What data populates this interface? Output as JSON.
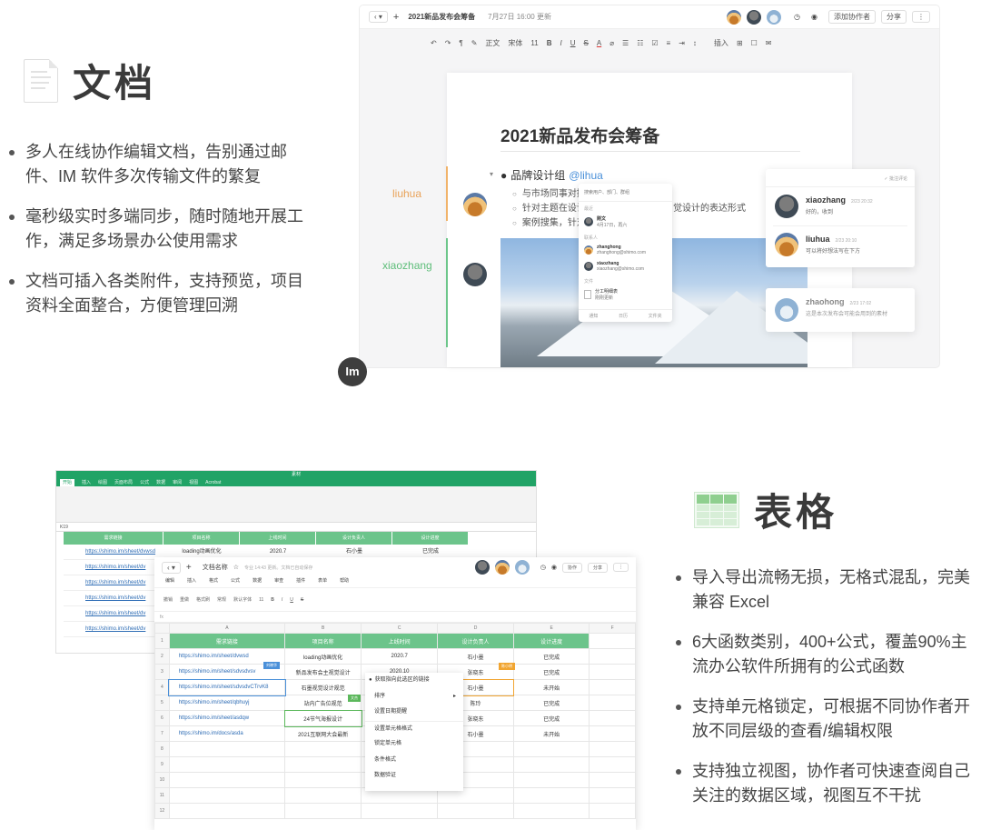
{
  "doc_section": {
    "title": "文档",
    "bullets": [
      "多人在线协作编辑文档，告别通过邮件、IM 软件多次传输文件的繁复",
      "毫秒级实时多端同步，随时随地开展工作，满足多场景办公使用需求",
      "文档可插入各类附件，支持预览，项目资料全面整合，方便管理回溯"
    ]
  },
  "doc_editor": {
    "file_name": "2021新品发布会筹备",
    "updated": "7月27日 16:00 更新",
    "add_collaborator": "添加协作者",
    "share": "分享",
    "toolbar": [
      "正文",
      "宋体",
      "11",
      "B",
      "I",
      "U",
      "S",
      "A",
      "插入"
    ],
    "heading": "2021新品发布会筹备",
    "item": "品牌设计组",
    "mention": "@lihua",
    "sub_items": [
      "与市场同事对接",
      "针对主题在设计",
      "案例搜集，针对"
    ],
    "sub_item_tail": "觉设计的表达形式",
    "margin_labels": [
      "liuhua",
      "xiaozhang"
    ],
    "mention_popup": {
      "search": "搜索用户、部门、群组",
      "recent_label": "最近",
      "contacts_label": "联系人",
      "file_label": "文件",
      "entries": [
        {
          "name": "刚文",
          "sub": "4月17日，再六"
        },
        {
          "name": "zhanghong",
          "sub": "zhanghong@shimo.com"
        },
        {
          "name": "xiaozhang",
          "sub": "xiaozhang@shimo.com"
        },
        {
          "name": "分工明细表",
          "sub": "刚刚更新"
        }
      ],
      "footer": [
        "通知",
        "日历",
        "文件夹"
      ]
    },
    "comments_header": "批注评论",
    "comments": [
      {
        "name": "xiaozhang",
        "time": "2/23 20:32",
        "text": "好的，收到"
      },
      {
        "name": "liuhua",
        "time": "2/23 20:10",
        "text": "可以将好想法写在下方"
      },
      {
        "name": "zhaohong",
        "time": "2/23 17:02",
        "text": "这是本次发布会可能会用到的素材"
      }
    ],
    "logo": "Im"
  },
  "excel": {
    "title": "素材",
    "tabs": [
      "开始",
      "插入",
      "绘图",
      "页面布局",
      "公式",
      "数据",
      "审阅",
      "视图",
      "Acrobat"
    ],
    "cell_ref": "K19",
    "headers": [
      "需求链接",
      "项目名称",
      "上线时间",
      "设计负责人",
      "设计进度"
    ],
    "row": [
      "https://shimo.im/sheet/dvwsd",
      "loading动画优化",
      "2020.7",
      "石小墨",
      "已完成"
    ],
    "more_links": [
      "https://shimo.im/sheet/dv",
      "https://shimo.im/sheet/dv",
      "https://shimo.im/sheet/dv",
      "https://shimo.im/sheet/dv",
      "https://shimo.im/sheet/dv"
    ]
  },
  "shimo_sheet": {
    "file_name": "文档名称",
    "saved": "专业 14:43 更新。文档已自动保存",
    "collaborate": "协作",
    "share": "分享",
    "menu": [
      "编辑",
      "插入",
      "格式",
      "公式",
      "数据",
      "审查",
      "插件",
      "表单",
      "帮助"
    ],
    "toolbar": [
      "撤销",
      "重做",
      "格式刷",
      "常规",
      "默认字体",
      "11",
      "B",
      "I",
      "U",
      "S"
    ],
    "columns": [
      "A",
      "B",
      "C",
      "D",
      "E",
      "F"
    ],
    "headers": [
      "需求链接",
      "项目名称",
      "上线时间",
      "设计负责人",
      "设计进度"
    ],
    "rows": [
      [
        "https://shimo.im/sheet/dvwsd",
        "loading动画优化",
        "2020.7",
        "石小墨",
        "已完成"
      ],
      [
        "https://shimo.im/sheet/sdvsdvsv",
        "新品发布会主视觉设计",
        "2020.10",
        "张晓东",
        "已完成"
      ],
      [
        "https://shimo.im/sheet/sdvsdvCTrvK8",
        "石墨视觉设计规范",
        "",
        "石小墨",
        "未开始"
      ],
      [
        "https://shimo.im/sheet/qbhuyj",
        "站内广告位规范",
        "",
        "陈玲",
        "已完成"
      ],
      [
        "https://shimo.im/sheet/asdqw",
        "24节气海报设计",
        "",
        "张晓东",
        "已完成"
      ],
      [
        "https://shimo.im/docs/asda",
        "2021互联网大会最新",
        "",
        "石小墨",
        "未开始"
      ]
    ],
    "row_numbers": [
      "1",
      "2",
      "3",
      "4",
      "5",
      "6",
      "7",
      "8",
      "9",
      "10",
      "11",
      "12"
    ],
    "tags": {
      "liuhua": "刘晓华",
      "xiaozhang": "陈小明",
      "wenjie": "文杰"
    },
    "context_menu": [
      "获取指向此选区的链接",
      "排序",
      "设置日期提醒",
      "设置单元格格式",
      "锁定单元格",
      "条件格式",
      "数据验证"
    ]
  },
  "sheet_section": {
    "title": "表格",
    "bullets": [
      "导入导出流畅无损，无格式混乱，完美兼容 Excel",
      "6大函数类别，400+公式，覆盖90%主流办公软件所拥有的公式函数",
      "支持单元格锁定，可根据不同协作者开放不同层级的查看/编辑权限",
      "支持独立视图，协作者可快速查阅自己关注的数据区域，视图互不干扰"
    ]
  }
}
